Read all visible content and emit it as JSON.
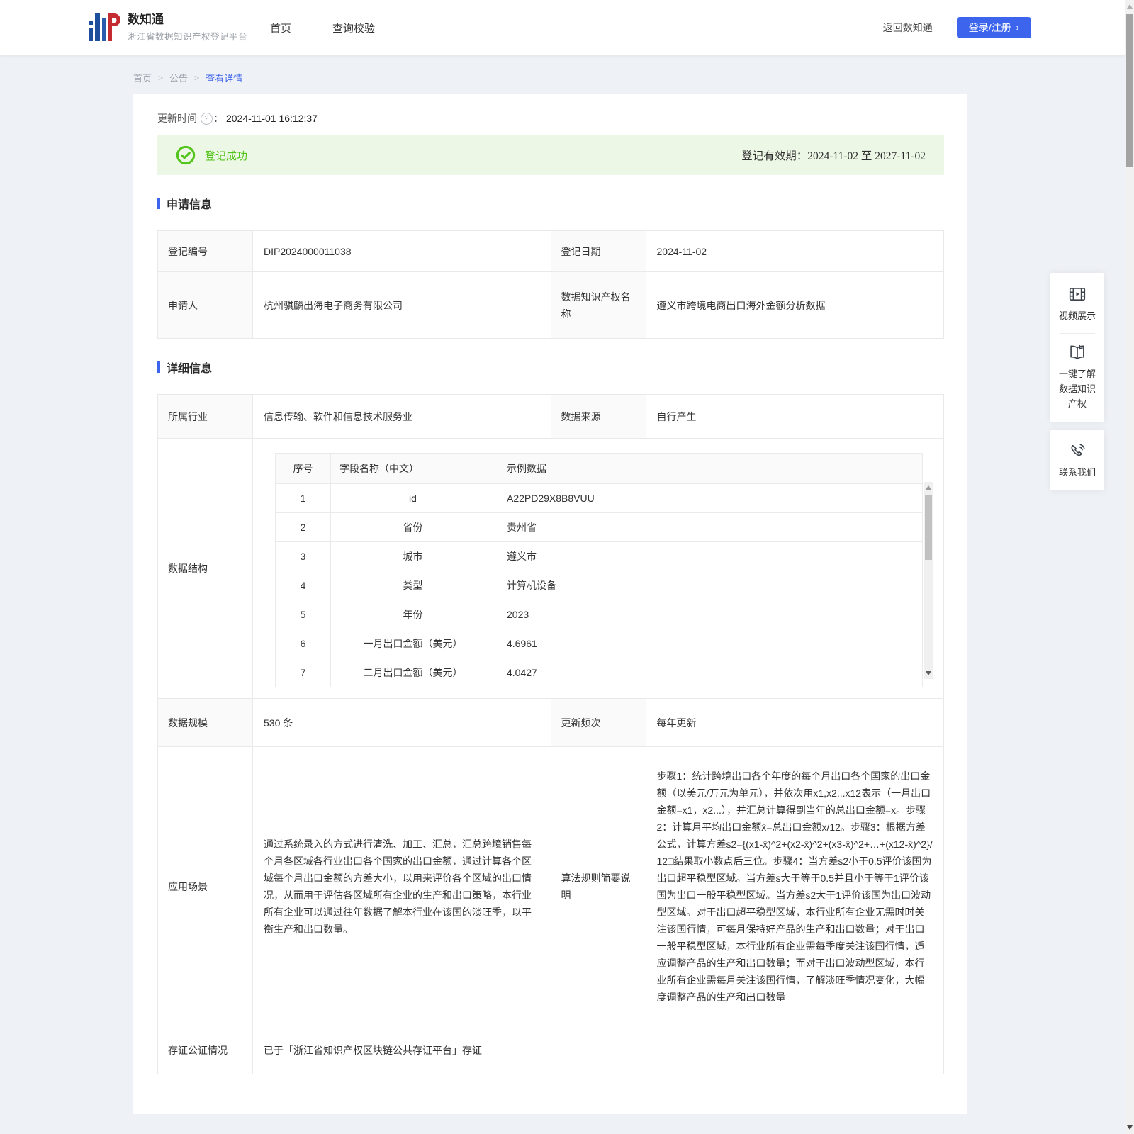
{
  "colors": {
    "primary": "#3c64ec",
    "success": "#52c41a",
    "success_bg": "#edf7e6"
  },
  "header": {
    "logo_title": "数知通",
    "logo_subtitle": "浙江省数据知识产权登记平台",
    "nav_home": "首页",
    "nav_query": "查询校验",
    "back_link": "返回数知通",
    "login_button": "登录/注册",
    "login_arrow": "›"
  },
  "breadcrumb": {
    "home": "首页",
    "sep1": ">",
    "announcement": "公告",
    "sep2": ">",
    "current": "查看详情"
  },
  "meta": {
    "update_time_label": "更新时间",
    "question_mark": "?",
    "colon": "：",
    "update_time": "2024-11-01 16:12:37"
  },
  "banner": {
    "status": "登记成功",
    "validity_label": "登记有效期：",
    "validity_value": "2024-11-02 至 2027-11-02"
  },
  "apply_info": {
    "title": "申请信息",
    "reg_no_label": "登记编号",
    "reg_no": "DIP2024000011038",
    "reg_date_label": "登记日期",
    "reg_date": "2024-11-02",
    "applicant_label": "申请人",
    "applicant": "杭州骐麟出海电子商务有限公司",
    "ip_name_label": "数据知识产权名称",
    "ip_name": "遵义市跨境电商出口海外金额分析数据"
  },
  "detail_info": {
    "title": "详细信息",
    "industry_label": "所属行业",
    "industry": "信息传输、软件和信息技术服务业",
    "source_label": "数据来源",
    "source": "自行产生",
    "structure_label": "数据结构",
    "structure_table": {
      "headers": [
        "序号",
        "字段名称（中文）",
        "示例数据"
      ],
      "rows": [
        [
          "1",
          "id",
          "A22PD29X8B8VUU"
        ],
        [
          "2",
          "省份",
          "贵州省"
        ],
        [
          "3",
          "城市",
          "遵义市"
        ],
        [
          "4",
          "类型",
          "计算机设备"
        ],
        [
          "5",
          "年份",
          "2023"
        ],
        [
          "6",
          "一月出口金额（美元）",
          "4.6961"
        ],
        [
          "7",
          "二月出口金额（美元）",
          "4.0427"
        ]
      ]
    },
    "scale_label": "数据规模",
    "scale": "530 条",
    "frequency_label": "更新频次",
    "frequency": "每年更新",
    "scenario_label": "应用场景",
    "scenario": "通过系统录入的方式进行清洗、加工、汇总，汇总跨境销售每个月各区域各行业出口各个国家的出口金额，通过计算各个区域每个月出口金额的方差大小，以用来评价各个区域的出口情况，从而用于评估各区域所有企业的生产和出口策略，本行业所有企业可以通过往年数据了解本行业在该国的淡旺季，以平衡生产和出口数量。",
    "algorithm_label": "算法规则简要说明",
    "algorithm": "步骤1：统计跨境出口各个年度的每个月出口各个国家的出口金额（以美元/万元为单元），并依次用x1,x2...x12表示（一月出口金额=x1，x2...），并汇总计算得到当年的总出口金额=x。步骤2：计算月平均出口金额x̄=总出口金额x/12。步骤3：根据方差公式，计算方差s2={(x1-x̄)^2+(x2-x̄)^2+(x3-x̄)^2+…+(x12-x̄)^2}/12□结果取小数点后三位。步骤4：当方差s2小于0.5评价该国为出口超平稳型区域。当方差s大于等于0.5并且小于等于1评价该国为出口一般平稳型区域。当方差s2大于1评价该国为出口波动型区域。对于出口超平稳型区域，本行业所有企业无需时时关注该国行情，可每月保持好产品的生产和出口数量；对于出口一般平稳型区域，本行业所有企业需每季度关注该国行情，适应调整产品的生产和出口数量；而对于出口波动型区域，本行业所有企业需每月关注该国行情，了解淡旺季情况变化，大幅度调整产品的生产和出口数量",
    "evidence_label": "存证公证情况",
    "evidence": "已于「浙江省知识产权区块链公共存证平台」存证"
  },
  "float_panel": {
    "video": "视频展示",
    "learn": "一键了解数据知识产权",
    "contact": "联系我们"
  }
}
